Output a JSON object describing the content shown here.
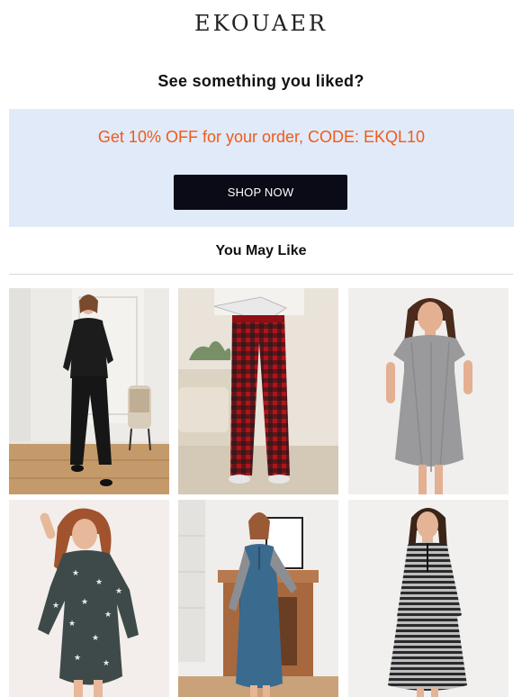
{
  "brand": {
    "name": "EKOUAER"
  },
  "headline": "See something you liked?",
  "promo": {
    "text": "Get 10% OFF for your order, CODE: EKQL10",
    "button_label": "SHOP NOW",
    "background": "#e1eaf8",
    "text_color": "#f05a1a"
  },
  "section": {
    "title": "You May Like"
  },
  "products": [
    {
      "image": "black-button-up-pajama-set"
    },
    {
      "image": "red-black-plaid-pajama-pants"
    },
    {
      "image": "gray-short-sleeve-nightgown"
    },
    {
      "image": "star-print-sleep-shirt"
    },
    {
      "image": "blue-henley-nightgown"
    },
    {
      "image": "striped-long-nightgown"
    }
  ]
}
